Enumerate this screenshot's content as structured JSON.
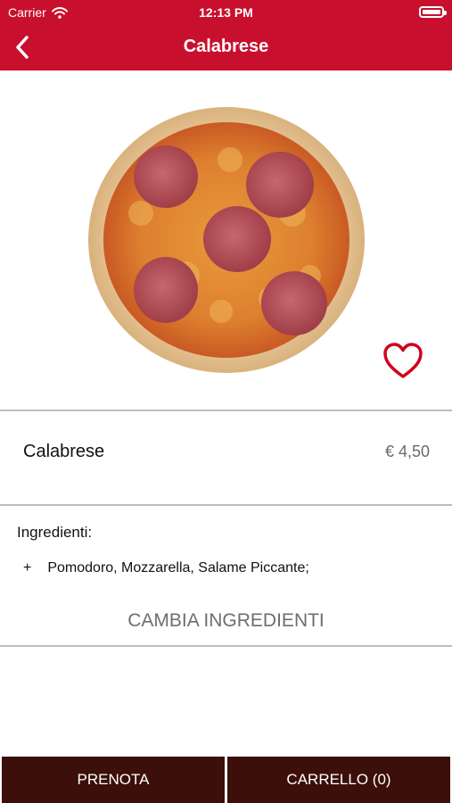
{
  "status_bar": {
    "carrier": "Carrier",
    "time": "12:13 PM",
    "battery_level": 1.0
  },
  "nav": {
    "title": "Calabrese",
    "back_icon": "chevron-left-icon"
  },
  "product": {
    "name": "Calabrese",
    "price": "€ 4,50",
    "favorite_icon": "heart-outline-icon"
  },
  "ingredients": {
    "heading": "Ingredienti:",
    "items": [
      {
        "marker": "+",
        "text": "Pomodoro, Mozzarella, Salame Piccante;"
      }
    ],
    "change_label": "CAMBIA INGREDIENTI"
  },
  "footer": {
    "book_label": "PRENOTA",
    "cart_label": "CARRELLO (0)"
  },
  "colors": {
    "brand_red": "#c8102e",
    "footer_brown": "#3c0f0a"
  }
}
